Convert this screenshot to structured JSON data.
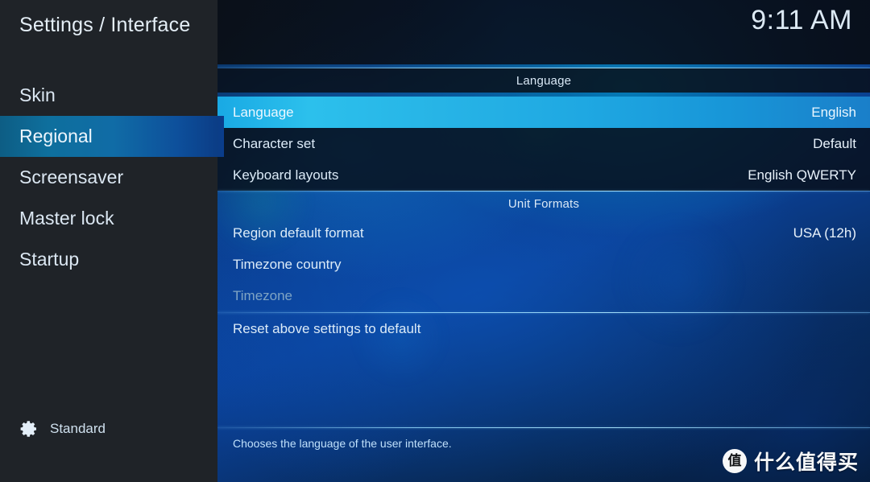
{
  "window": {
    "title": "Settings / Interface",
    "clock": "9:11 AM"
  },
  "sidebar": {
    "items": [
      {
        "label": "Skin",
        "selected": false
      },
      {
        "label": "Regional",
        "selected": true
      },
      {
        "label": "Screensaver",
        "selected": false
      },
      {
        "label": "Master lock",
        "selected": false
      },
      {
        "label": "Startup",
        "selected": false
      }
    ],
    "settings_level": {
      "icon": "gear-icon",
      "label": "Standard"
    }
  },
  "main": {
    "sections": [
      {
        "header": "Language",
        "rows": [
          {
            "label": "Language",
            "value": "English",
            "selected": true,
            "disabled": false
          },
          {
            "label": "Character set",
            "value": "Default",
            "selected": false,
            "disabled": false
          },
          {
            "label": "Keyboard layouts",
            "value": "English QWERTY",
            "selected": false,
            "disabled": false
          }
        ]
      },
      {
        "header": "Unit Formats",
        "rows": [
          {
            "label": "Region default format",
            "value": "USA (12h)",
            "selected": false,
            "disabled": false
          },
          {
            "label": "Timezone country",
            "value": "",
            "selected": false,
            "disabled": false
          },
          {
            "label": "Timezone",
            "value": "",
            "selected": false,
            "disabled": true
          }
        ]
      },
      {
        "header": "",
        "rows": [
          {
            "label": "Reset above settings to default",
            "value": "",
            "selected": false,
            "disabled": false
          }
        ]
      }
    ],
    "help_text": "Chooses the language of the user interface."
  },
  "watermark": {
    "badge": "值",
    "text": "什么值得买"
  },
  "colors": {
    "sidebar_bg": "#1f2328",
    "selected_row": "#27b4e6",
    "sidebar_selected": "#106ca6",
    "accent_rule": "#9adcff",
    "text_primary": "#dcebf8",
    "text_disabled": "#7fa4c4"
  }
}
